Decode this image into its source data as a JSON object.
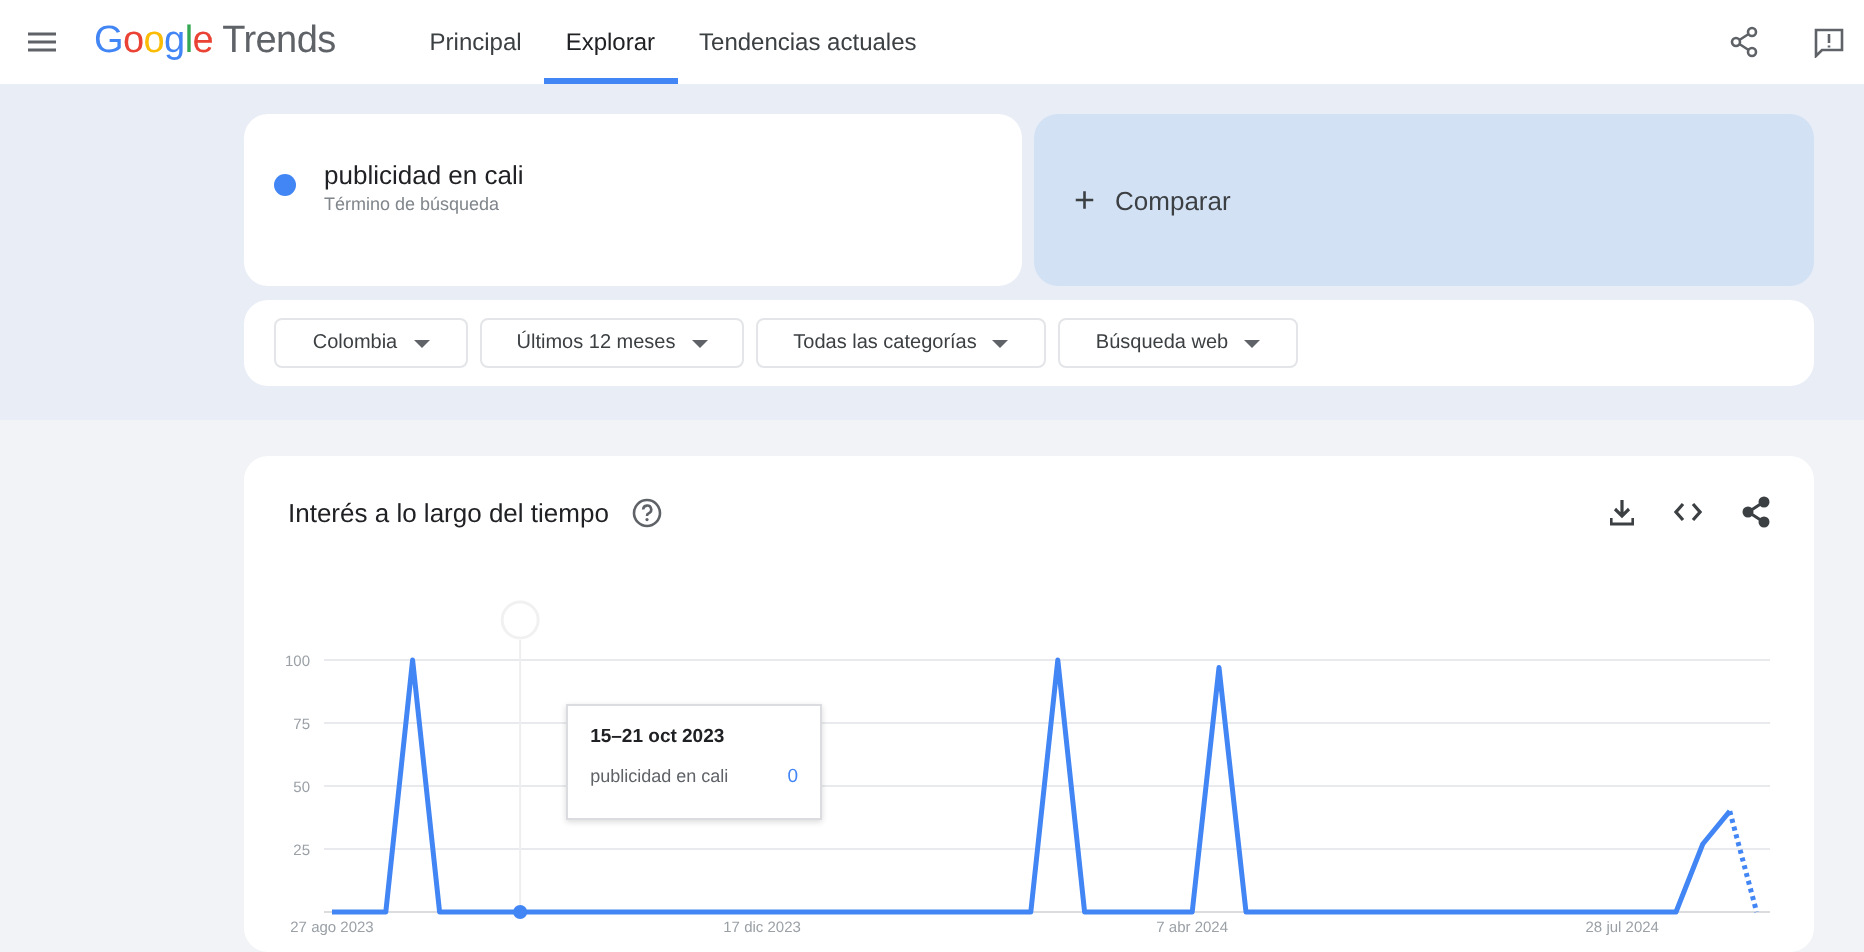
{
  "header": {
    "logo": "Google Trends",
    "tabs": [
      {
        "label": "Principal",
        "selected": false
      },
      {
        "label": "Explorar",
        "selected": true
      },
      {
        "label": "Tendencias actuales",
        "selected": false
      }
    ]
  },
  "search_term": {
    "term": "publicidad en cali",
    "subtitle": "Término de búsqueda",
    "color": "#4285f4"
  },
  "compare": {
    "icon": "+",
    "label": "Comparar"
  },
  "filters": [
    "Colombia",
    "Últimos 12 meses",
    "Todas las categorías",
    "Búsqueda web"
  ],
  "interest_chart": {
    "title": "Interés a lo largo del tiempo",
    "last_point_partial": true,
    "tooltip": {
      "date": "15–21 oct 2023",
      "value": "0"
    },
    "chart_data": {
      "type": "line",
      "categories": [
        "27 ago 2023",
        null,
        null,
        null,
        null,
        null,
        null,
        null,
        null,
        null,
        null,
        null,
        null,
        null,
        null,
        null,
        "17 dic 2023",
        null,
        null,
        null,
        null,
        null,
        null,
        null,
        null,
        null,
        null,
        null,
        null,
        null,
        null,
        null,
        "7 abr 2024",
        null,
        null,
        null,
        null,
        null,
        null,
        null,
        null,
        null,
        null,
        null,
        null,
        null,
        null,
        null,
        "28 jul 2024",
        null,
        null,
        null,
        null,
        null
      ],
      "series": [
        {
          "name": "publicidad en cali",
          "color": "#4285f4",
          "values": [
            0,
            0,
            0,
            100,
            0,
            0,
            0,
            0,
            0,
            0,
            0,
            0,
            0,
            0,
            0,
            0,
            0,
            0,
            0,
            0,
            0,
            0,
            0,
            0,
            0,
            0,
            0,
            100,
            0,
            0,
            0,
            0,
            0,
            97,
            0,
            0,
            0,
            0,
            0,
            0,
            0,
            0,
            0,
            0,
            0,
            0,
            0,
            0,
            0,
            0,
            0,
            27,
            40,
            0
          ]
        }
      ],
      "ylim": [
        0,
        100
      ],
      "yticks": [
        25,
        50,
        75,
        100
      ],
      "grid": true
    }
  }
}
